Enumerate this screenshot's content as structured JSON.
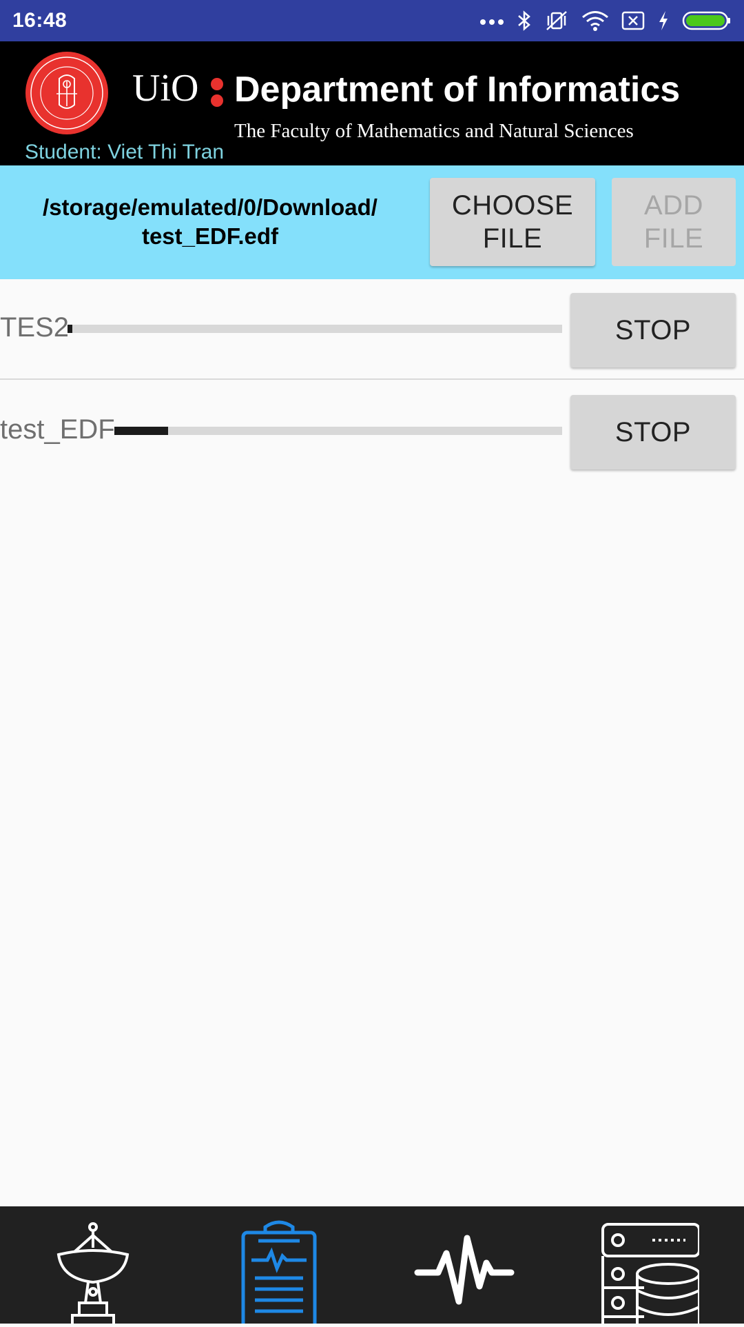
{
  "status_bar": {
    "time": "16:48",
    "icons": [
      "more-dots-icon",
      "bluetooth-icon",
      "vibrate-off-icon",
      "wifi-icon",
      "sim-x-icon",
      "charging-bolt-icon",
      "battery-icon"
    ],
    "battery_color": "#4cc81b"
  },
  "header": {
    "uio": "UiO",
    "department": "Department of Informatics",
    "faculty": "The Faculty of Mathematics and Natural Sciences",
    "student": "Student: Viet Thi Tran",
    "accent_color": "#e8322e"
  },
  "file_bar": {
    "path_line1": "/storage/emulated/0/Download/",
    "path_line2": "test_EDF.edf",
    "choose_label_1": "CHOOSE",
    "choose_label_2": "FILE",
    "add_label_1": "ADD",
    "add_label_2": "FILE",
    "background": "#84e0fb"
  },
  "uploads": [
    {
      "name": "TES2",
      "progress": 0.01,
      "button": "STOP"
    },
    {
      "name": "test_EDF",
      "progress": 0.12,
      "button": "STOP"
    }
  ],
  "bottom_nav": {
    "items": [
      {
        "icon": "satellite-antenna-icon",
        "active": false
      },
      {
        "icon": "clipboard-ecg-icon",
        "active": true
      },
      {
        "icon": "pulse-waveform-icon",
        "active": false
      },
      {
        "icon": "server-database-icon",
        "active": false
      }
    ],
    "active_color": "#1e88e5"
  }
}
